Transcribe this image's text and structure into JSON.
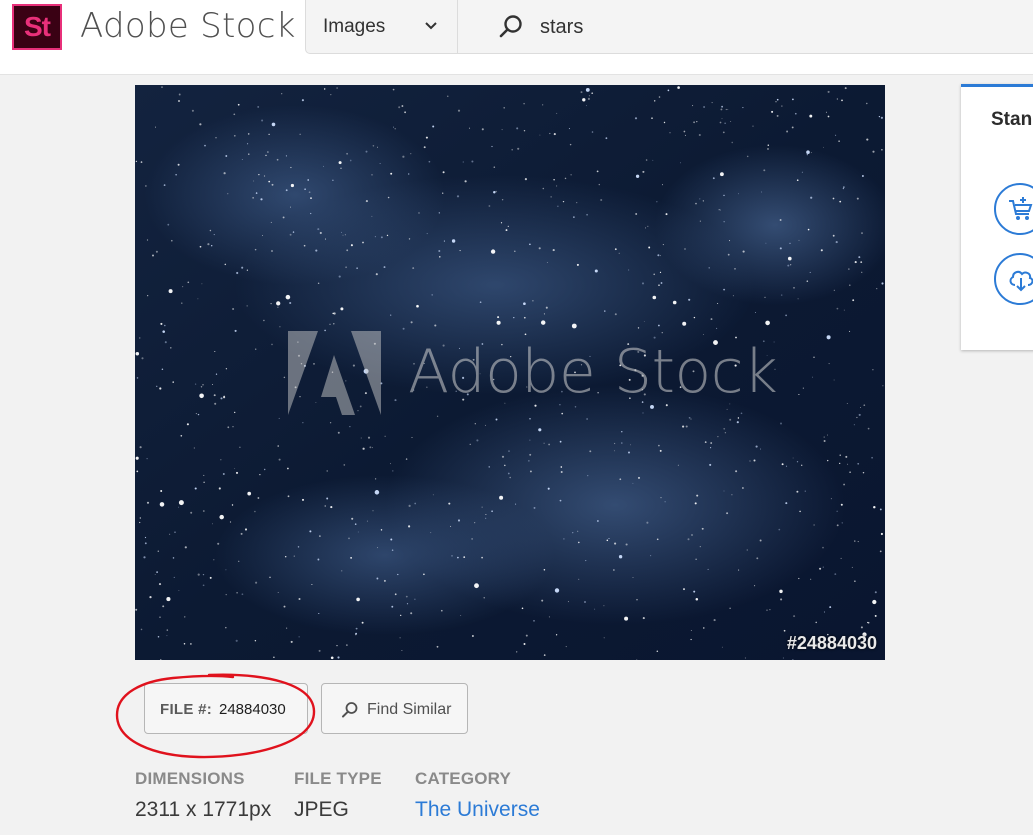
{
  "header": {
    "logo_mark": "St",
    "brand": "Adobe Stock",
    "type_select": {
      "value": "Images"
    },
    "search": {
      "value": "stars"
    }
  },
  "preview": {
    "watermark": "Adobe Stock",
    "file_id_overlay": "#24884030"
  },
  "actions": {
    "file_number_label": "FILE #:",
    "file_number_value": "24884030",
    "find_similar_label": "Find Similar"
  },
  "meta": {
    "dimensions_label": "DIMENSIONS",
    "dimensions_value": "2311 x 1771px",
    "file_type_label": "FILE TYPE",
    "file_type_value": "JPEG",
    "category_label": "CATEGORY",
    "category_value": "The Universe"
  },
  "side_panel": {
    "tab_label": "Stan"
  },
  "colors": {
    "accent": "#2c7bd6",
    "logo_pink": "#e8307a",
    "logo_bg": "#3a0114",
    "annotation_red": "#e0121d"
  }
}
